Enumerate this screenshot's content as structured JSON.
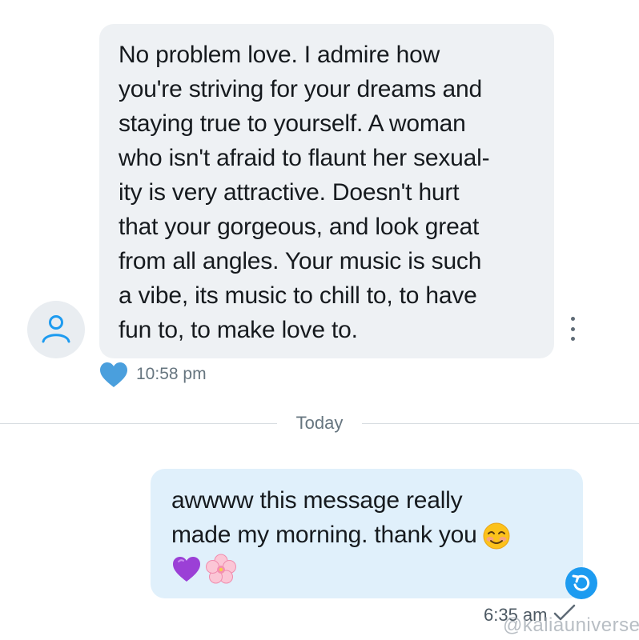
{
  "incoming_message": {
    "lines": [
      "No problem love. I admire how",
      "you're striving for your dreams and",
      "staying true to yourself. A woman",
      "who isn't afraid to flaunt her sexual-",
      "ity is very attractive. Doesn't hurt",
      "that your gorgeous, and look great",
      "from all angles. Your music is such",
      "a vibe, its music to chill to, to have",
      "fun to, to make love to."
    ],
    "time": "10:58 pm",
    "liked": true,
    "avatar_icon": "default-user-icon",
    "more_icon": "more-vertical-icon"
  },
  "divider": {
    "label": "Today"
  },
  "outgoing_message": {
    "line1": "awwww this message really",
    "line2": "made my morning. thank you",
    "emojis_line2": [
      "smiling-blush-emoji"
    ],
    "emojis_line3": [
      "purple-heart-emoji",
      "cherry-blossom-emoji"
    ],
    "time": "6:35 am",
    "status_icon": "sent-check-icon",
    "reply_icon": "reply-arrow-icon"
  },
  "watermark": "@kaliauniverse",
  "colors": {
    "incoming_bubble": "#eef1f4",
    "outgoing_bubble": "#e0f0fb",
    "accent": "#1d9bf0",
    "heart": "#4a9fdd",
    "text": "#161a1e",
    "meta": "#66757f"
  }
}
